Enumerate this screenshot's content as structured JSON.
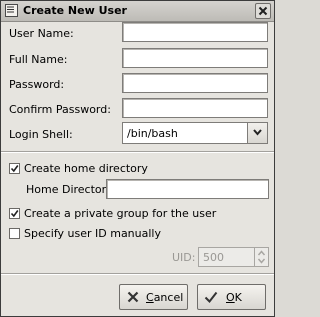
{
  "window": {
    "title": "Create New User",
    "close_icon": "close-icon",
    "title_icon": "window-menu-icon"
  },
  "form": {
    "user_name": {
      "label": "User Name:",
      "value": ""
    },
    "full_name": {
      "label": "Full Name:",
      "value": ""
    },
    "password": {
      "label": "Password:",
      "value": ""
    },
    "confirm_password": {
      "label": "Confirm Password:",
      "value": ""
    },
    "login_shell": {
      "label": "Login Shell:",
      "value": "/bin/bash",
      "icon": "chevron-down-icon"
    },
    "create_home": {
      "label": "Create home directory",
      "checked": true
    },
    "home_directory": {
      "label": "Home Directory:",
      "value": ""
    },
    "private_group": {
      "label": "Create a private group for the user",
      "checked": true
    },
    "specify_uid": {
      "label": "Specify user ID manually",
      "checked": false
    },
    "uid": {
      "label": "UID:",
      "value": "500",
      "enabled": false
    }
  },
  "buttons": {
    "cancel": {
      "mnemonic": "C",
      "rest": "ancel",
      "icon": "cancel-x-icon"
    },
    "ok": {
      "mnemonic": "O",
      "rest": "K",
      "icon": "checkmark-icon"
    }
  },
  "colors": {
    "window_bg": "#e6e4df",
    "titlebar": "#c9c7c2",
    "disabled_text": "#9a9894"
  }
}
